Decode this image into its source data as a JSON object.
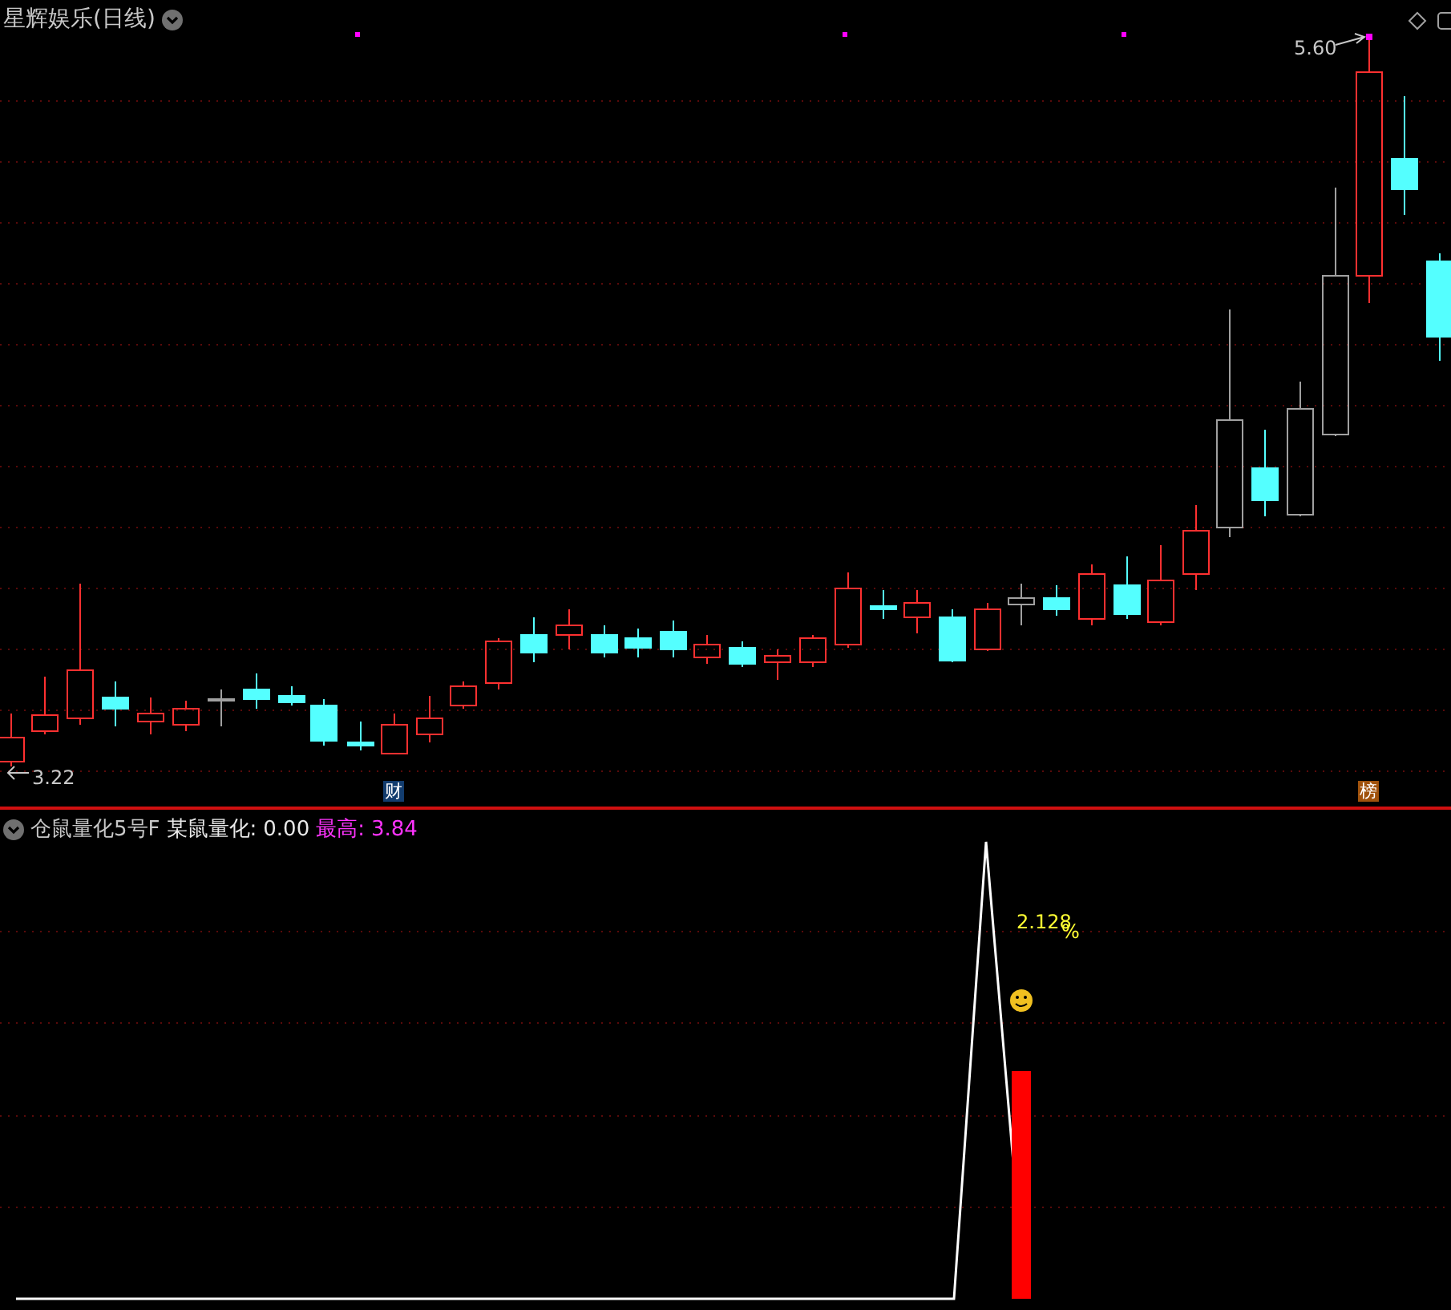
{
  "price_chart": {
    "title": "星辉娱乐(日线)",
    "high_label": "5.60",
    "low_label": "3.22",
    "badges": [
      {
        "text": "财",
        "color": "#123c6e"
      },
      {
        "text": "榜",
        "color": "#a0520c"
      }
    ]
  },
  "indicator": {
    "name": "仓鼠量化5号F",
    "value_label": "某鼠量化:",
    "value": "0.00",
    "max_label": "最高:",
    "max_value": "3.84",
    "annotation": "2.128",
    "annotation_unit": "%"
  }
}
